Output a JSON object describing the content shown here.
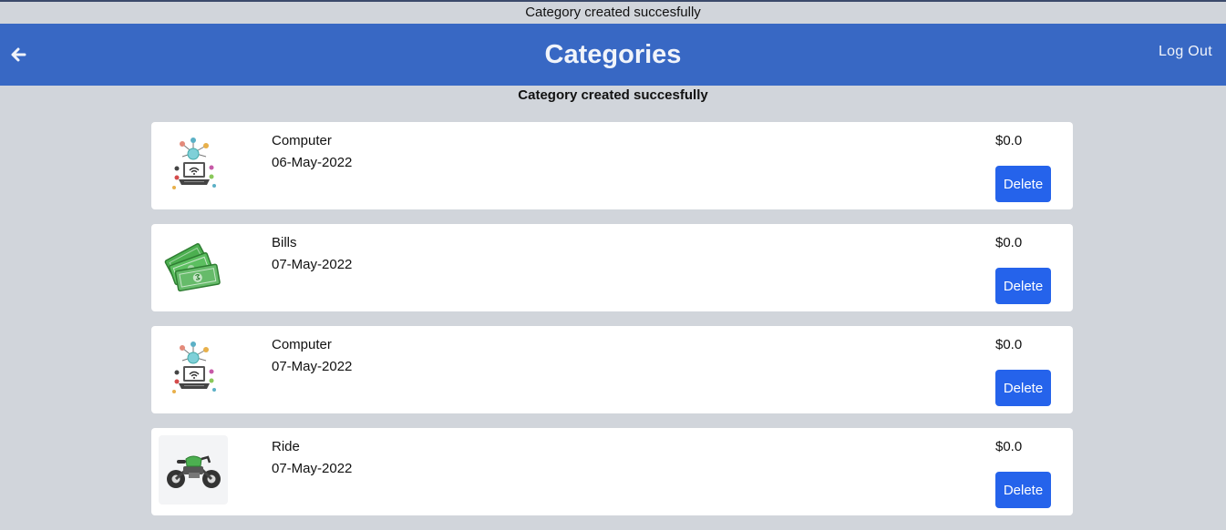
{
  "toast": {
    "text": "Category created succesfully"
  },
  "navbar": {
    "back_icon": "arrow-left-icon",
    "title": "Categories",
    "logout_label": "Log Out"
  },
  "flash": {
    "text": "Category created succesfully"
  },
  "categories": [
    {
      "name": "Computer",
      "date": "06-May-2022",
      "amount": "$0.0",
      "delete_label": "Delete",
      "icon": "computer-network-icon"
    },
    {
      "name": "Bills",
      "date": "07-May-2022",
      "amount": "$0.0",
      "delete_label": "Delete",
      "icon": "money-bills-icon"
    },
    {
      "name": "Computer",
      "date": "07-May-2022",
      "amount": "$0.0",
      "delete_label": "Delete",
      "icon": "computer-network-icon"
    },
    {
      "name": "Ride",
      "date": "07-May-2022",
      "amount": "$0.0",
      "delete_label": "Delete",
      "icon": "motorcycle-icon"
    }
  ],
  "colors": {
    "navbar": "#3868c4",
    "background": "#d1d5db",
    "delete_button": "#2563eb",
    "card": "#ffffff"
  }
}
